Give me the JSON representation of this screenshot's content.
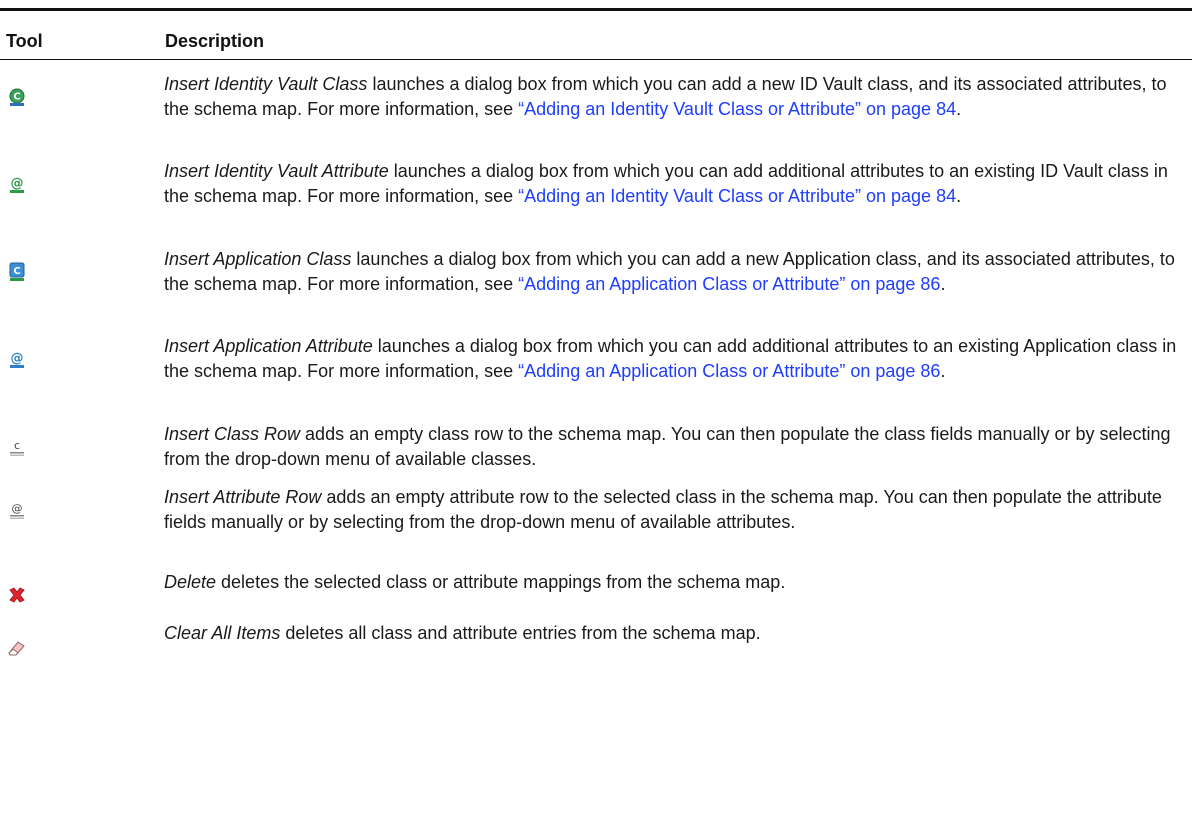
{
  "table": {
    "headers": {
      "tool": "Tool",
      "description": "Description"
    },
    "rows": [
      {
        "icon": "insert-identity-vault-class-icon",
        "name": "Insert Identity Vault Class",
        "text": " launches a dialog box from which you can add a new ID Vault class, and its associated attributes, to the schema map. For more information, see ",
        "link": "“Adding an Identity Vault Class or Attribute” on page 84",
        "end": "."
      },
      {
        "icon": "insert-identity-vault-attribute-icon",
        "name": "Insert Identity Vault Attribute",
        "text": " launches a dialog box from which you can add additional attributes to an existing ID Vault class in the schema map. For more information, see ",
        "link": "“Adding an Identity Vault Class or Attribute” on page 84",
        "end": "."
      },
      {
        "icon": "insert-application-class-icon",
        "name": "Insert Application Class",
        "text": " launches a dialog box from which you can add a new Application class, and its associated attributes, to the schema map. For more information, see ",
        "link": "“Adding an Application Class or Attribute” on page 86",
        "end": "."
      },
      {
        "icon": "insert-application-attribute-icon",
        "name": "Insert Application Attribute",
        "text": " launches a dialog box from which you can add additional attributes to an existing Application class in the schema map. For more information, see ",
        "link": "“Adding an Application Class or Attribute” on page 86",
        "end": "."
      },
      {
        "icon": "insert-class-row-icon",
        "name": "Insert Class Row",
        "text": " adds an empty class row to the schema map. You can then populate the class fields manually or by selecting from the drop-down menu of available classes."
      },
      {
        "icon": "insert-attribute-row-icon",
        "name": "Insert Attribute Row",
        "text": " adds an empty attribute row to the selected class in the schema map. You can then populate the attribute fields manually or by selecting from the drop-down menu of available attributes."
      },
      {
        "icon": "delete-icon",
        "name": "Delete",
        "text": " deletes the selected class or attribute mappings from the schema map."
      },
      {
        "icon": "eraser-icon",
        "name": "Clear All Items",
        "text": " deletes all class and attribute entries from the schema map."
      }
    ]
  },
  "colors": {
    "link": "#1f3dff",
    "rule": "#111111",
    "text": "#1a1a1a"
  }
}
